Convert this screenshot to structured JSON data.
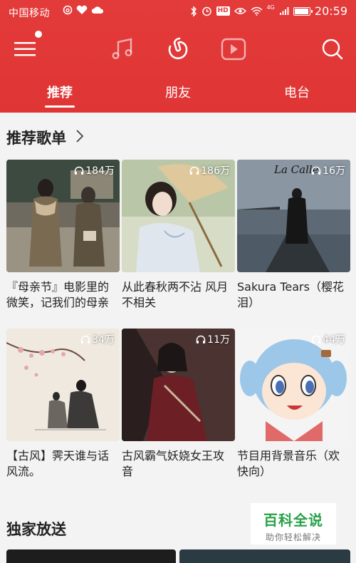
{
  "statusbar": {
    "carrier": "中国移动",
    "hd_badge": "HD",
    "network": "4G",
    "time": "20:59"
  },
  "nav": {
    "icons": [
      "menu-icon",
      "music-note-icon",
      "netease-logo-icon",
      "video-play-icon",
      "search-icon"
    ]
  },
  "tabs": [
    {
      "label": "推荐",
      "active": true
    },
    {
      "label": "朋友",
      "active": false
    },
    {
      "label": "电台",
      "active": false
    }
  ],
  "recommended": {
    "title": "推荐歌单",
    "playlists": [
      {
        "count": "184万",
        "title": "『母亲节』电影里的微笑，记我们的母亲"
      },
      {
        "count": "186万",
        "title": "从此春秋两不沾 风月不相关"
      },
      {
        "count": "16万",
        "title": "Sakura Tears（樱花泪）",
        "cover_text": "La Calle"
      },
      {
        "count": "34万",
        "title": "【古风】霁天谁与话风流。"
      },
      {
        "count": "11万",
        "title": "古风霸气妖娆女王攻音"
      },
      {
        "count": "44万",
        "title": "节目用背景音乐（欢快向）"
      }
    ]
  },
  "exclusive": {
    "title": "独家放送"
  },
  "watermark": {
    "main": "百科全说",
    "sub": "助你轻松解决"
  },
  "colors": {
    "brand_red": "#e33a3a",
    "watermark_green": "#27a048"
  }
}
